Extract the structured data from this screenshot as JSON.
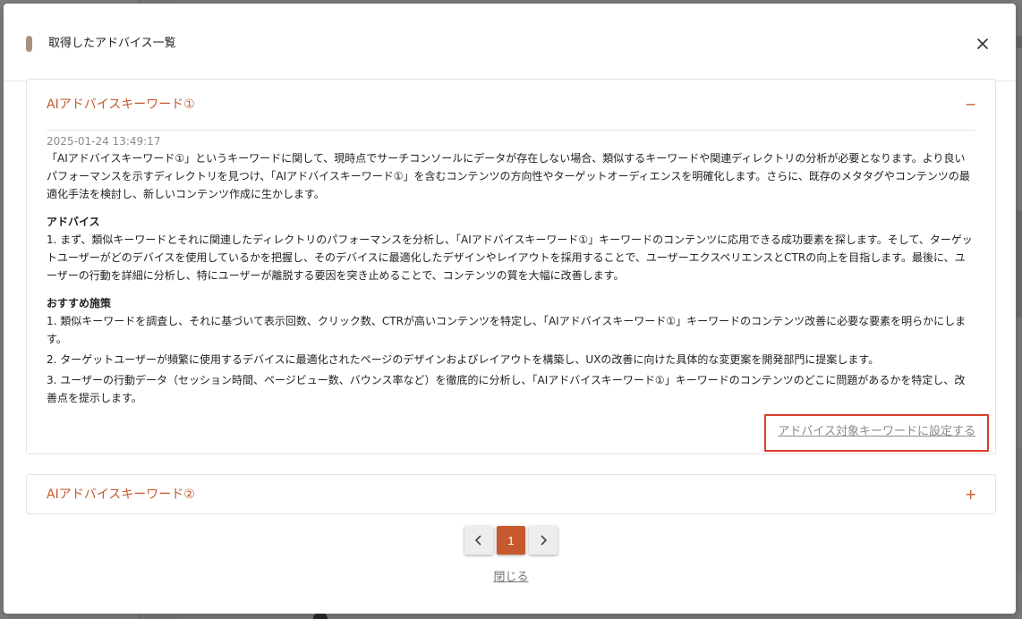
{
  "modal": {
    "title": "取得したアドバイス一覧",
    "close_icon": "close-icon"
  },
  "accordions": [
    {
      "title": "AIアドバイスキーワード①",
      "toggle": "−",
      "expanded": true,
      "timestamp": "2025-01-24 13:49:17",
      "intro": "「AIアドバイスキーワード①」というキーワードに関して、現時点でサーチコンソールにデータが存在しない場合、類似するキーワードや関連ディレクトリの分析が必要となります。より良いパフォーマンスを示すディレクトリを見つけ、「AIアドバイスキーワード①」を含むコンテンツの方向性やターゲットオーディエンスを明確化します。さらに、既存のメタタグやコンテンツの最適化手法を検討し、新しいコンテンツ作成に生かします。",
      "advice_heading": "アドバイス",
      "advice_text": "1. まず、類似キーワードとそれに関連したディレクトリのパフォーマンスを分析し、「AIアドバイスキーワード①」キーワードのコンテンツに応用できる成功要素を探します。そして、ターゲットユーザーがどのデバイスを使用しているかを把握し、そのデバイスに最適化したデザインやレイアウトを採用することで、ユーザーエクスペリエンスとCTRの向上を目指します。最後に、ユーザーの行動を詳細に分析し、特にユーザーが離脱する要因を突き止めることで、コンテンツの質を大幅に改善します。",
      "measures_heading": "おすすめ施策",
      "measures": [
        "1. 類似キーワードを調査し、それに基づいて表示回数、クリック数、CTRが高いコンテンツを特定し、「AIアドバイスキーワード①」キーワードのコンテンツ改善に必要な要素を明らかにします。",
        "2. ターゲットユーザーが頻繁に使用するデバイスに最適化されたページのデザインおよびレイアウトを構築し、UXの改善に向けた具体的な変更案を開発部門に提案します。",
        "3. ユーザーの行動データ（セッション時間、ページビュー数、バウンス率など）を徹底的に分析し、「AIアドバイスキーワード①」キーワードのコンテンツのどこに問題があるかを特定し、改善点を提示します。"
      ],
      "action_label": "アドバイス対象キーワードに設定する"
    },
    {
      "title": "AIアドバイスキーワード②",
      "toggle": "+",
      "expanded": false
    }
  ],
  "pagination": {
    "current_page": "1",
    "prev_icon": "chevron-left-icon",
    "next_icon": "chevron-right-icon"
  },
  "footer": {
    "close_label": "閉じる"
  },
  "colors": {
    "accent": "#c65a2e",
    "highlight_border": "#d9402b",
    "title_marker": "#a89281"
  }
}
